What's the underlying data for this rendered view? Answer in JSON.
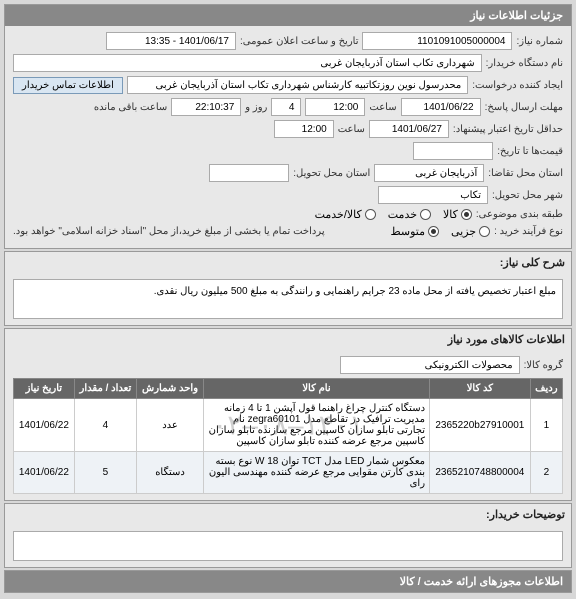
{
  "header": {
    "title": "جزئیات اطلاعات نیاز"
  },
  "info": {
    "need_no_label": "شماره نیاز:",
    "need_no": "1101091005000004",
    "public_datetime_label": "تاریخ و ساعت اعلان عمومی:",
    "public_datetime": "1401/06/17 - 13:35",
    "buyer_label": "نام دستگاه خریدار:",
    "buyer": "شهرداری تکاب استان آذربایجان غربی",
    "requester_label": "ایجاد کننده درخواست:",
    "requester": "محدرسول نوین روزتکاتبیه کارشناس شهرداری تکاب استان آذربایجان غربی",
    "contact_btn": "اطلاعات تماس خریدار",
    "send_deadline_label": "مهلت ارسال پاسخ:",
    "send_date": "1401/06/22",
    "send_time_label": "ساعت",
    "send_time": "12:00",
    "days_label": "روز و",
    "days_value": "4",
    "remain_time": "22:10:37",
    "remain_label": "ساعت باقی مانده",
    "valid_deadline_label": "حداقل تاریخ اعتبار پیشنهاد:",
    "valid_date": "1401/06/27",
    "valid_time_label": "ساعت",
    "valid_time": "12:00",
    "price_date_label": "قیمت‌ها تا تاریخ:",
    "req_province_label": "استان محل تقاضا:",
    "req_province": "آذربایجان غربی",
    "deliver_province_label": "استان محل تحویل:",
    "deliver_city_label": "شهر محل تحویل:",
    "deliver_city": "تکاب",
    "category_label": "طبقه بندی موضوعی:",
    "cat_goods": "کالا",
    "cat_service": "خدمت",
    "cat_goods_service": "کالا/خدمت",
    "process_type_label": "نوع فرآیند خرید :",
    "proc_small": "جزیی",
    "proc_medium": "متوسط",
    "payment_note": "پرداخت تمام یا بخشی از مبلغ خرید،از محل \"اسناد خزانه اسلامی\" خواهد بود."
  },
  "desc": {
    "header": "شرح کلی نیاز:",
    "text": "مبلع اعتبار تخصیص یافته از محل ماده 23 جرایم راهنمایی و رانندگی  به مبلغ 500 میلیون ریال نقدی."
  },
  "items_section": {
    "header": "اطلاعات کالاهای مورد نیاز",
    "group_label": "گروه کالا:",
    "group_value": "محصولات الکترونیکی",
    "columns": {
      "row": "ردیف",
      "code": "کد کالا",
      "name": "نام کالا",
      "unit": "واحد شمارش",
      "qty": "تعداد / مقدار",
      "date": "تاریخ نیاز"
    },
    "rows": [
      {
        "idx": "1",
        "code": "2365220b27910001",
        "name": "دستگاه کنترل چراغ راهنما قول آپشن 1 تا 4 زمانه مدیریت ترافیک در تقاطع مدل zegra60101 نام تجارتی تابلو سازان کاسپین مرجع سازنده تابلو سازان کاسپین مرجع عرضه کننده تابلو سازان کاسپین",
        "unit": "عدد",
        "qty": "4",
        "date": "1401/06/22"
      },
      {
        "idx": "2",
        "code": "2365210748800004",
        "name": "معکوس شمار LED مدل TCT توان W 18 نوع بسته بندی کارتن مقوایی مرجع عرضه کننده مهندسی الیون رای",
        "unit": "دستگاه",
        "qty": "5",
        "date": "1401/06/22"
      }
    ]
  },
  "buyer_notes": {
    "header": "توضیحات خریدار:"
  },
  "permits": {
    "header": "اطلاعات مجوزهای ارائه خدمت / کالا"
  },
  "watermark": "۱۴۰۱–۰۸–۰۲"
}
